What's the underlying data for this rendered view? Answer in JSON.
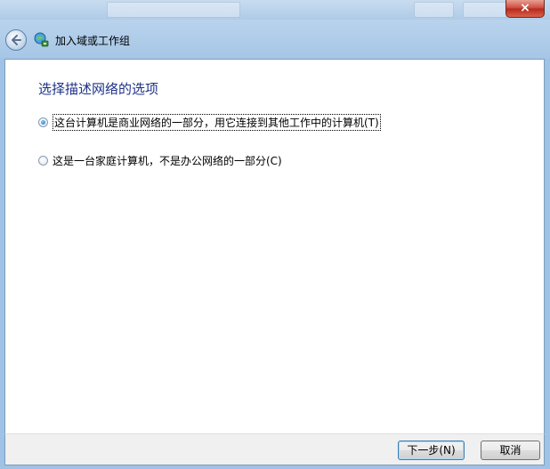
{
  "window": {
    "close_label": "×"
  },
  "nav": {
    "title": "加入域或工作组",
    "back_icon": "back-arrow-icon",
    "wizard_icon": "network-join-icon"
  },
  "main": {
    "heading": "选择描述网络的选项",
    "options": [
      {
        "label": "这台计算机是商业网络的一部分，用它连接到其他工作中的计算机(T)",
        "checked": true
      },
      {
        "label": "这是一台家庭计算机，不是办公网络的一部分(C)",
        "checked": false
      }
    ]
  },
  "footer": {
    "next_label": "下一步(N)",
    "cancel_label": "取消"
  },
  "colors": {
    "heading": "#1e3287",
    "frame": "#9ec3e6",
    "close_button": "#c9483a"
  }
}
